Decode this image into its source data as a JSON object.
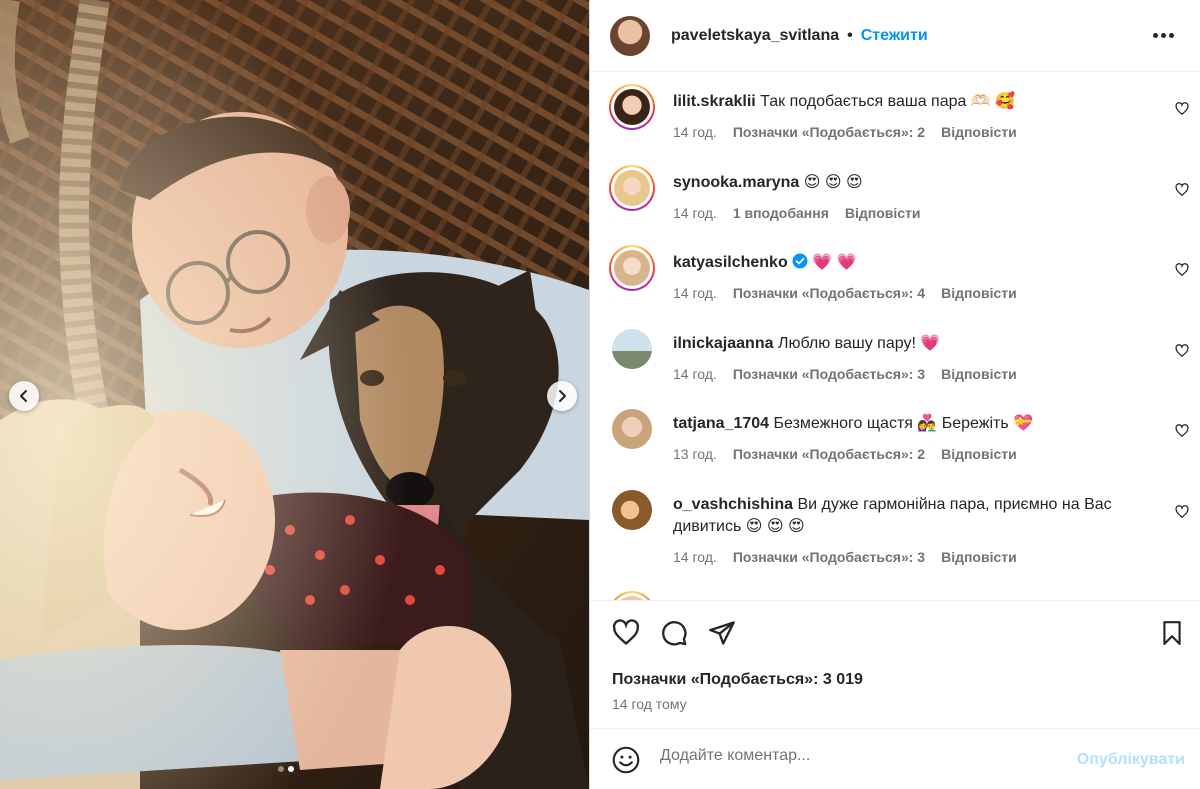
{
  "header": {
    "username": "paveletskaya_svitlana",
    "separator": "•",
    "follow_label": "Стежити",
    "more_icon": "more-horizontal-icon"
  },
  "comments": [
    {
      "user": "lilit.skraklii",
      "text": "Так подобається ваша пара 🫶🏻 🥰",
      "time": "14 год.",
      "likes": "Позначки «Подобається»: 2",
      "reply": "Відповісти",
      "story_ring": true
    },
    {
      "user": "synooka.maryna",
      "text": "😍 😍 😍",
      "time": "14 год.",
      "likes": "1 вподобання",
      "reply": "Відповісти",
      "story_ring": true
    },
    {
      "user": "katyasilchenko",
      "verified": true,
      "text": "💗 💗",
      "time": "14 год.",
      "likes": "Позначки «Подобається»: 4",
      "reply": "Відповісти",
      "story_ring": true
    },
    {
      "user": "ilnickajaanna",
      "text": "Люблю вашу пару! 💗",
      "time": "14 год.",
      "likes": "Позначки «Подобається»: 3",
      "reply": "Відповісти",
      "story_ring": false
    },
    {
      "user": "tatjana_1704",
      "text": "Безмежного щастя 👩‍❤️‍👨  Бережіть 💝",
      "time": "13 год.",
      "likes": "Позначки «Подобається»: 2",
      "reply": "Відповісти",
      "story_ring": false
    },
    {
      "user": "o_vashchishina",
      "text": "Ви дуже гармонійна пара, приємно на Вас дивитись 😍 😍 😍",
      "time": "14 год.",
      "likes": "Позначки «Подобається»: 3",
      "reply": "Відповісти",
      "story_ring": false
    }
  ],
  "post": {
    "likes": "Позначки «Подобається»: 3 019",
    "time": "14 год тому"
  },
  "composer": {
    "placeholder": "Додайте коментар...",
    "publish_label": "Опублікувати"
  },
  "colors": {
    "accent": "#0095f6",
    "publish_disabled": "#b2dffc",
    "meta_text": "#737373",
    "primary_text": "#262626"
  },
  "carousel": {
    "slide_count": 2,
    "active_index": 1
  }
}
